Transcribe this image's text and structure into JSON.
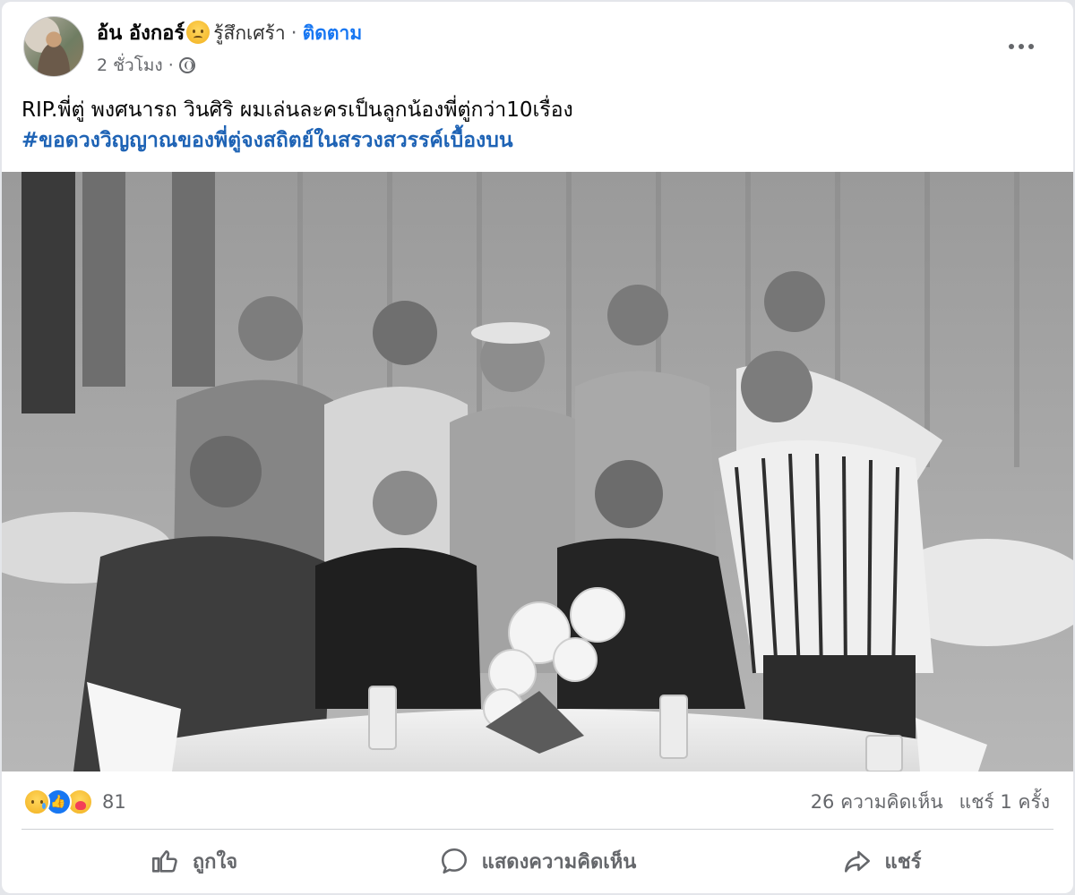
{
  "post": {
    "author_name": "อ้น อังกอร์",
    "feeling_text": "รู้สึกเศร้า",
    "separator": "·",
    "follow_label": "ติดตาม",
    "timestamp": "2 ชั่วโมง ·",
    "audience_icon": "globe-icon",
    "body_line1": "RIP.พี่ตู่ พงศนารถ วินศิริ ผมเล่นละครเป็นลูกน้องพี่ตู่กว่า10เรื่อง",
    "hashtag": "#ขอดวงวิญญาณของพี่ตู่จงสถิตย์ในสรวงสวรรค์เบื้องบน"
  },
  "reactions": {
    "icons": [
      "sad-reaction-icon",
      "like-reaction-icon",
      "care-reaction-icon"
    ],
    "count": "81",
    "comments": "26 ความคิดเห็น",
    "shares": "แชร์ 1 ครั้ง"
  },
  "actions": {
    "like_label": "ถูกใจ",
    "comment_label": "แสดงความคิดเห็น",
    "share_label": "แชร์"
  },
  "colors": {
    "link": "#1877f2",
    "hashtag": "#1e63b5",
    "secondary_text": "#65676b"
  }
}
